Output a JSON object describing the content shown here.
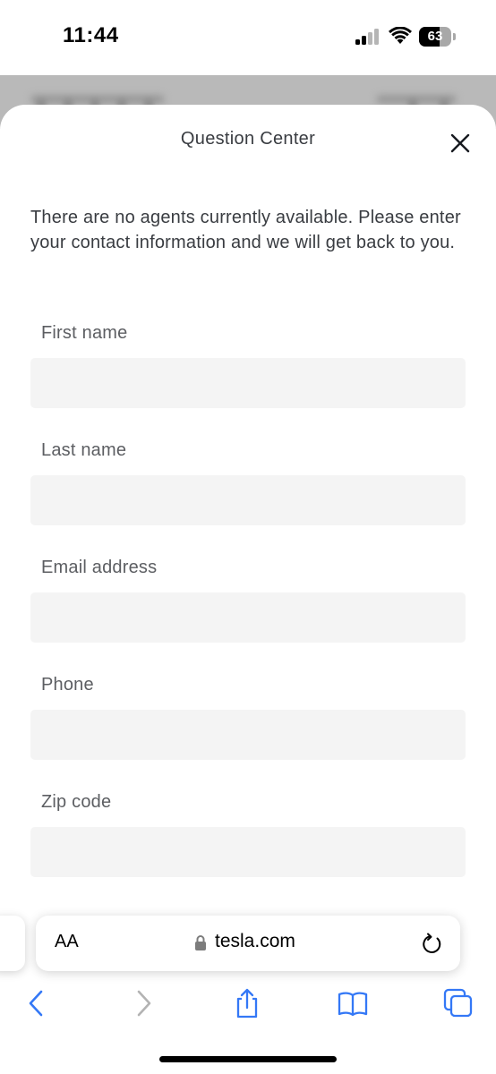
{
  "status_bar": {
    "time": "11:44",
    "battery": "63",
    "battery_level": 0.63
  },
  "sheet": {
    "title": "Question Center",
    "intro": "There are no agents currently available. Please enter your contact information and we will get back to you.",
    "fields": [
      {
        "label": "First name",
        "value": ""
      },
      {
        "label": "Last name",
        "value": ""
      },
      {
        "label": "Email address",
        "value": ""
      },
      {
        "label": "Phone",
        "value": ""
      },
      {
        "label": "Zip code",
        "value": ""
      }
    ]
  },
  "browser": {
    "text_size_label": "AA",
    "url": "tesla.com",
    "icons": [
      "lock-icon",
      "reload-icon",
      "back-icon",
      "forward-icon",
      "share-icon",
      "bookmarks-icon",
      "tabs-icon"
    ]
  },
  "colors": {
    "accent": "#3478f6",
    "disabled": "#b3b3b3",
    "input_bg": "#f4f4f4",
    "label": "#5c5e62"
  }
}
